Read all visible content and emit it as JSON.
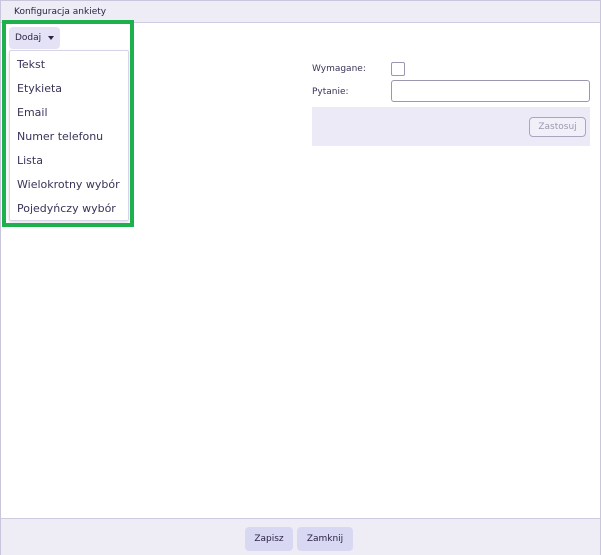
{
  "window": {
    "title": "Konfiguracja ankiety"
  },
  "toolbar": {
    "add_label": "Dodaj"
  },
  "add_menu": {
    "items": [
      {
        "label": "Tekst"
      },
      {
        "label": "Etykieta"
      },
      {
        "label": "Email"
      },
      {
        "label": "Numer telefonu"
      },
      {
        "label": "Lista"
      },
      {
        "label": "Wielokrotny wybór"
      },
      {
        "label": "Pojedyńczy wybór"
      }
    ]
  },
  "form": {
    "required_label": "Wymagane:",
    "question_label": "Pytanie:",
    "question_value": "",
    "apply_label": "Zastosuj"
  },
  "footer": {
    "save_label": "Zapisz",
    "close_label": "Zamknij"
  },
  "colors": {
    "highlight": "#1db04c",
    "button_bg": "#d9d8f2",
    "panel_bg": "#eceaf6"
  }
}
